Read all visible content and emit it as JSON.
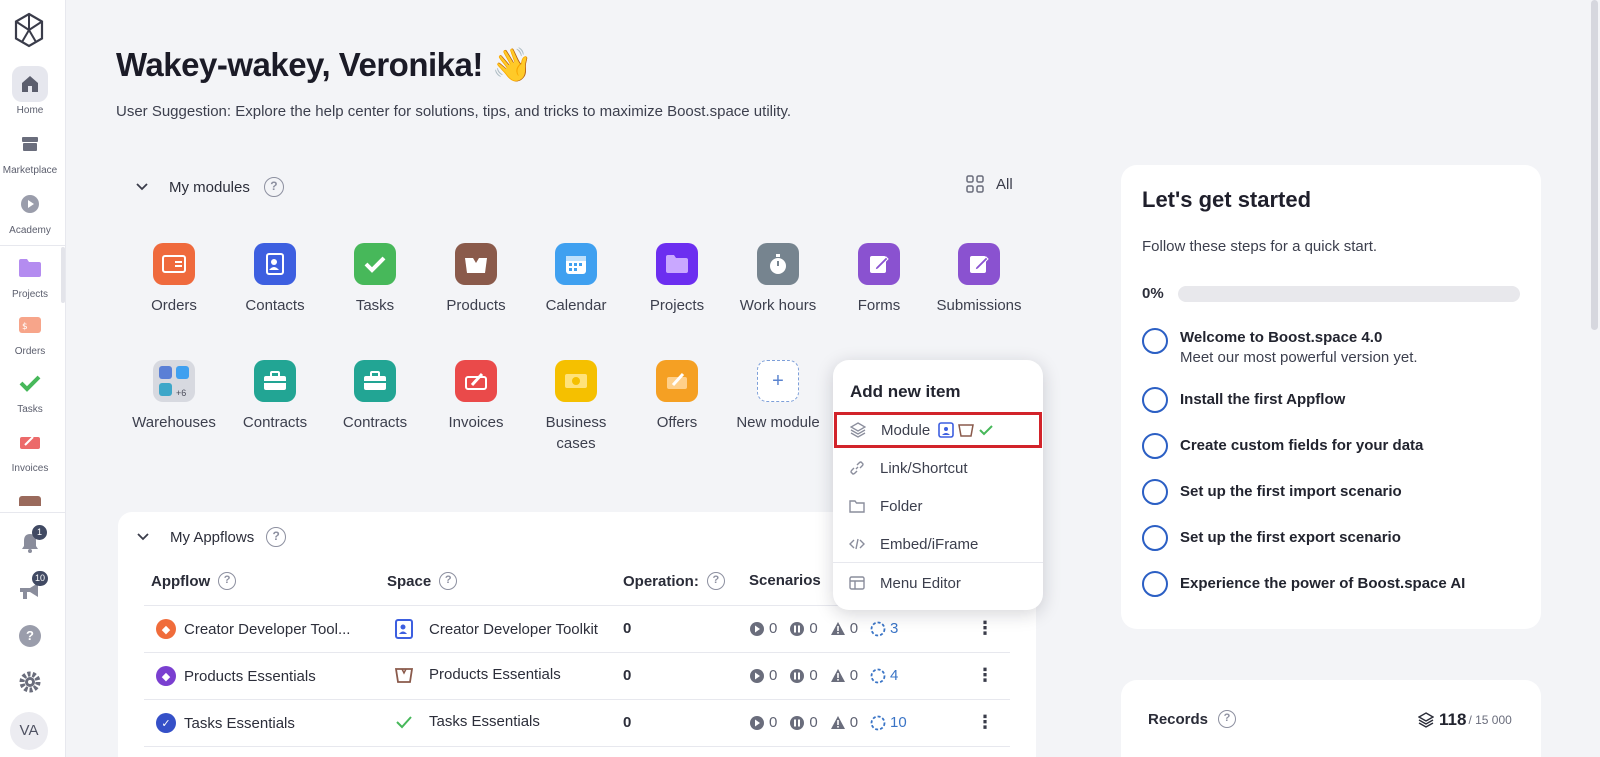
{
  "sidebar": {
    "items": [
      {
        "label": "Home",
        "icon": "home-icon"
      },
      {
        "label": "Marketplace",
        "icon": "store-icon"
      },
      {
        "label": "Academy",
        "icon": "play-icon"
      },
      {
        "label": "Projects",
        "icon": "folder-icon"
      },
      {
        "label": "Orders",
        "icon": "orders-icon"
      },
      {
        "label": "Tasks",
        "icon": "check-icon"
      },
      {
        "label": "Invoices",
        "icon": "invoice-icon"
      }
    ],
    "notifications_count": "1",
    "announcements_count": "10",
    "avatar_initials": "VA"
  },
  "header": {
    "greeting": "Wakey-wakey, Veronika! 👋",
    "suggestion": "User Suggestion: Explore the help center for solutions, tips, and tricks to maximize Boost.space utility."
  },
  "modules": {
    "title": "My modules",
    "all_label": "All",
    "items": [
      {
        "label": "Orders",
        "color": "#ef6a3d"
      },
      {
        "label": "Contacts",
        "color": "#3d5fe0"
      },
      {
        "label": "Tasks",
        "color": "#47b85a"
      },
      {
        "label": "Products",
        "color": "#8a5a4b"
      },
      {
        "label": "Calendar",
        "color": "#3fa0f0"
      },
      {
        "label": "Projects",
        "color": "#6c2ef0"
      },
      {
        "label": "Work hours",
        "color": "#76848f"
      },
      {
        "label": "Forms",
        "color": "#8a52d0"
      },
      {
        "label": "Submissions",
        "color": "#8a52d0"
      },
      {
        "label": "Warehouses",
        "color": "#d7d9e0"
      },
      {
        "label": "Contracts",
        "color": "#22a594"
      },
      {
        "label": "Contracts",
        "color": "#22a594"
      },
      {
        "label": "Invoices",
        "color": "#ea4a4a"
      },
      {
        "label": "Business cases",
        "color": "#f5c000"
      },
      {
        "label": "Offers",
        "color": "#f5a023"
      },
      {
        "label": "New module",
        "color": "#ffffff"
      }
    ],
    "warehouses_more": "+6"
  },
  "add_menu": {
    "title": "Add new item",
    "items": [
      {
        "label": "Module",
        "icon": "layers-icon"
      },
      {
        "label": "Link/Shortcut",
        "icon": "link-icon"
      },
      {
        "label": "Folder",
        "icon": "folder-icon"
      },
      {
        "label": "Embed/iFrame",
        "icon": "code-icon"
      },
      {
        "label": "Menu Editor",
        "icon": "table-icon"
      }
    ]
  },
  "appflows": {
    "title": "My Appflows",
    "columns": [
      "Appflow",
      "Space",
      "Operation:",
      "Scenarios"
    ],
    "rows": [
      {
        "appflow": "Creator Developer Tool...",
        "space": "Creator Developer Toolkit",
        "operations": "0",
        "running": "0",
        "paused": "0",
        "warnings": "0",
        "total": "3",
        "color": "#f06c3b"
      },
      {
        "appflow": "Products Essentials",
        "space": "Products Essentials",
        "operations": "0",
        "running": "0",
        "paused": "0",
        "warnings": "0",
        "total": "4",
        "color": "#7a3fd0"
      },
      {
        "appflow": "Tasks Essentials",
        "space": "Tasks Essentials",
        "operations": "0",
        "running": "0",
        "paused": "0",
        "warnings": "0",
        "total": "10",
        "color": "#3550c8"
      }
    ]
  },
  "getting_started": {
    "title": "Let's get started",
    "subtitle": "Follow these steps for a quick start.",
    "progress_label": "0%",
    "progress_fraction": 0,
    "steps": [
      {
        "title": "Welcome to Boost.space 4.0",
        "desc": "Meet our most powerful version yet."
      },
      {
        "title": "Install the first Appflow",
        "desc": ""
      },
      {
        "title": "Create custom fields for your data",
        "desc": ""
      },
      {
        "title": "Set up the first import scenario",
        "desc": ""
      },
      {
        "title": "Set up the first export scenario",
        "desc": ""
      },
      {
        "title": "Experience the power of Boost.space AI",
        "desc": ""
      }
    ]
  },
  "records": {
    "label": "Records",
    "value": "118",
    "limit": "/ 15 000"
  }
}
